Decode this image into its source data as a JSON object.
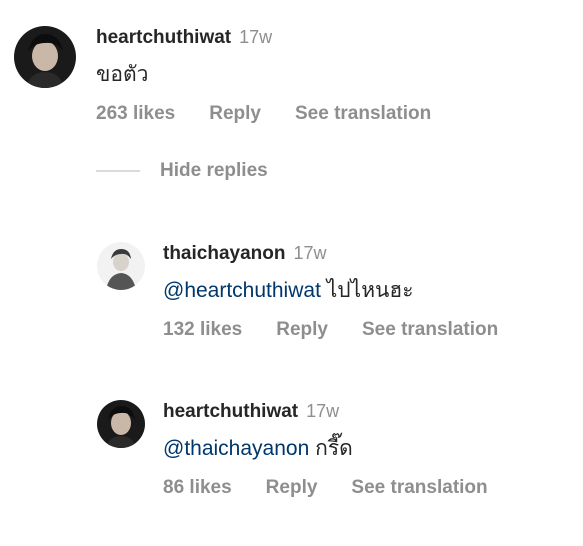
{
  "comments": [
    {
      "username": "heartchuthiwat",
      "time": "17w",
      "mention": "",
      "text": "ขอตัว",
      "likes": "263 likes",
      "reply": "Reply",
      "translate": "See translation"
    },
    {
      "username": "thaichayanon",
      "time": "17w",
      "mention": "@heartchuthiwat",
      "text": "ไปไหนฮะ",
      "likes": "132 likes",
      "reply": "Reply",
      "translate": "See translation"
    },
    {
      "username": "heartchuthiwat",
      "time": "17w",
      "mention": "@thaichayanon",
      "text": "กรี๊ด",
      "likes": "86 likes",
      "reply": "Reply",
      "translate": "See translation"
    }
  ],
  "hide_replies": "Hide replies",
  "colors": {
    "text": "#262626",
    "secondary": "#8e8e8e",
    "mention": "#00376b",
    "divider": "#dbdbdb"
  }
}
